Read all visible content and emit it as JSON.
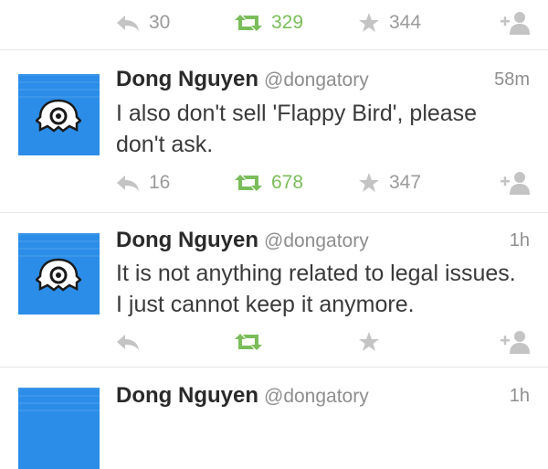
{
  "tweets": [
    {
      "id": "t0",
      "partial": true,
      "replies": "30",
      "retweets": "329",
      "favorites": "344"
    },
    {
      "id": "t1",
      "name": "Dong Nguyen",
      "handle": "@dongatory",
      "time": "58m",
      "text": "I also don't sell 'Flappy Bird', please don't ask.",
      "replies": "16",
      "retweets": "678",
      "favorites": "347"
    },
    {
      "id": "t2",
      "name": "Dong Nguyen",
      "handle": "@dongatory",
      "time": "1h",
      "text": "It is not anything related to legal issues. I just cannot keep it anymore.",
      "replies": "",
      "retweets": "",
      "favorites": ""
    },
    {
      "id": "t3",
      "partial": true,
      "name": "Dong Nguyen",
      "handle": "@dongatory",
      "time": "1h"
    }
  ],
  "colors": {
    "avatar_blue": "#2b8de8",
    "retweet_green": "#7bbd5a",
    "icon_gray": "#b8b8b8",
    "text_gray": "#8e8e8e"
  },
  "icons": [
    "reply-icon",
    "retweet-icon",
    "star-icon",
    "follow-icon",
    "ghost-avatar-icon"
  ]
}
